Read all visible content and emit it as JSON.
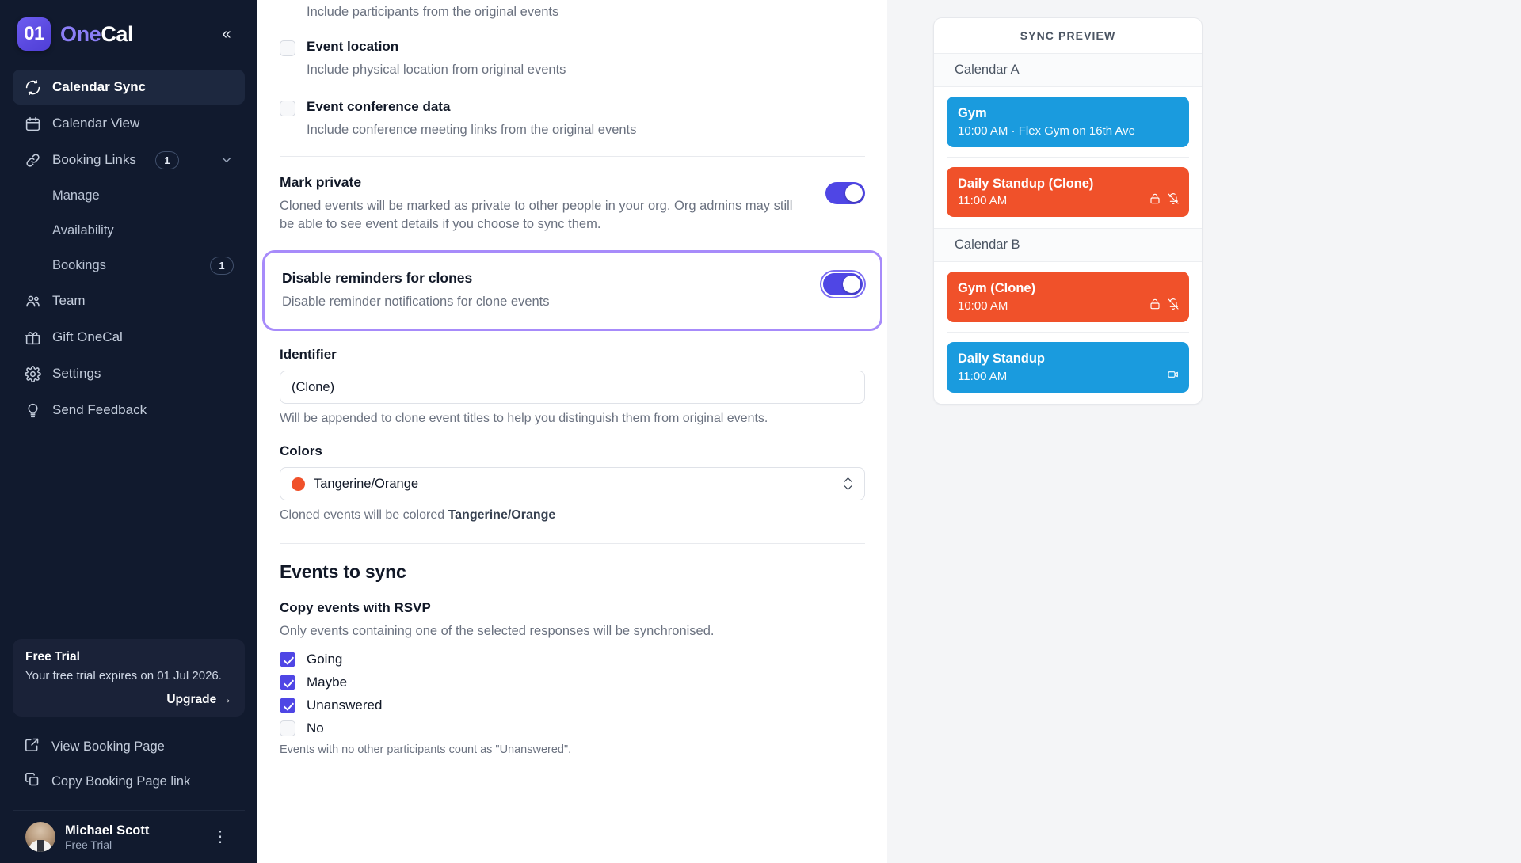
{
  "sidebar": {
    "logo_mark": "01",
    "logo_one": "One",
    "logo_cal": "Cal",
    "collapse_icon": "double-chevron-left-icon",
    "nav": [
      {
        "label": "Calendar Sync",
        "icon": "sync-icon",
        "active": true
      },
      {
        "label": "Calendar View",
        "icon": "calendar-icon",
        "active": false
      },
      {
        "label": "Booking Links",
        "icon": "link-icon",
        "badge": "1",
        "active": false
      }
    ],
    "sub_items": [
      {
        "label": "Manage",
        "badge": ""
      },
      {
        "label": "Availability",
        "badge": ""
      },
      {
        "label": "Bookings",
        "badge": "1"
      }
    ],
    "nav2": [
      {
        "label": "Team",
        "icon": "people-icon"
      },
      {
        "label": "Gift OneCal",
        "icon": "gift-icon"
      },
      {
        "label": "Settings",
        "icon": "gear-icon"
      },
      {
        "label": "Send Feedback",
        "icon": "lightbulb-icon"
      }
    ],
    "trial": {
      "title": "Free Trial",
      "text": "Your free trial expires on 01 Jul 2026.",
      "upgrade": "Upgrade →"
    },
    "links": [
      {
        "label": "View Booking Page",
        "icon": "external-link-icon"
      },
      {
        "label": "Copy Booking Page link",
        "icon": "copy-icon"
      }
    ],
    "user": {
      "name": "Michael Scott",
      "plan": "Free Trial",
      "menu_icon": "vertical-dots-icon"
    }
  },
  "form": {
    "partial_row": {
      "desc": "Include participants from the original events"
    },
    "checkboxes": [
      {
        "label": "Event location",
        "desc": "Include physical location from original events",
        "checked": false
      },
      {
        "label": "Event conference data",
        "desc": "Include conference meeting links from the original events",
        "checked": false
      }
    ],
    "mark_private": {
      "title": "Mark private",
      "desc": "Cloned events will be marked as private to other people in your org. Org admins may still be able to see event details if you choose to sync them.",
      "enabled": true
    },
    "disable_reminders": {
      "title": "Disable reminders for clones",
      "desc": "Disable reminder notifications for clone events",
      "enabled": true,
      "highlighted": true
    },
    "identifier": {
      "label": "Identifier",
      "value": "(Clone)",
      "placeholder": "(Clone)",
      "help": "Will be appended to clone event titles to help you distinguish them from original events."
    },
    "colors": {
      "label": "Colors",
      "value": "Tangerine/Orange",
      "swatch_hex": "#f0512a",
      "help_prefix": "Cloned events will be colored ",
      "help_value": "Tangerine/Orange"
    },
    "events_to_sync": {
      "title": "Events to sync",
      "rsvp_title": "Copy events with RSVP",
      "rsvp_desc": "Only events containing one of the selected responses will be synchronised.",
      "options": [
        {
          "label": "Going",
          "checked": true
        },
        {
          "label": "Maybe",
          "checked": true
        },
        {
          "label": "Unanswered",
          "checked": true
        },
        {
          "label": "No",
          "checked": false
        }
      ],
      "note": "Events with no other participants count as \"Unanswered\"."
    }
  },
  "preview": {
    "header": "SYNC PREVIEW",
    "calendars": [
      {
        "name": "Calendar A",
        "events": [
          {
            "title": "Gym",
            "sub": "10:00 AM · Flex Gym on 16th Ave",
            "color": "blue",
            "icons": []
          },
          {
            "title": "Daily Standup (Clone)",
            "sub": "11:00 AM",
            "color": "orange",
            "icons": [
              "lock-icon",
              "bell-off-icon"
            ]
          }
        ]
      },
      {
        "name": "Calendar B",
        "events": [
          {
            "title": "Gym (Clone)",
            "sub": "10:00 AM",
            "color": "orange",
            "icons": [
              "lock-icon",
              "bell-off-icon"
            ]
          },
          {
            "title": "Daily Standup",
            "sub": "11:00 AM",
            "color": "blue",
            "icons": [
              "video-icon"
            ]
          }
        ]
      }
    ]
  },
  "colors": {
    "accent": "#4f46e5",
    "highlight": "#a78bfa",
    "event_blue": "#1a9bde",
    "event_orange": "#f0512a",
    "sidebar_bg": "#111a2e"
  }
}
